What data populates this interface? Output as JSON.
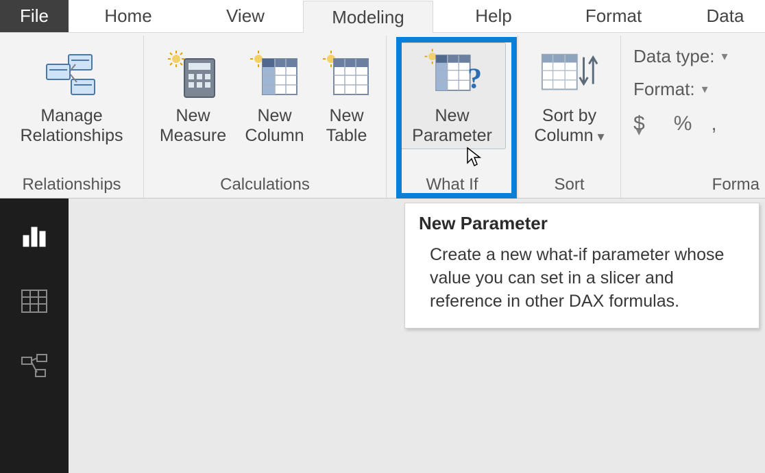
{
  "tabs": {
    "file": "File",
    "home": "Home",
    "view": "View",
    "modeling": "Modeling",
    "help": "Help",
    "format": "Format",
    "data": "Data"
  },
  "ribbon": {
    "relationships": {
      "group_label": "Relationships",
      "manage": "Manage\nRelationships"
    },
    "calculations": {
      "group_label": "Calculations",
      "new_measure": "New\nMeasure",
      "new_column": "New\nColumn",
      "new_table": "New\nTable"
    },
    "whatif": {
      "group_label": "What If",
      "new_parameter": "New\nParameter"
    },
    "sort": {
      "group_label": "Sort",
      "sort_by_column": "Sort by\nColumn"
    },
    "formatting": {
      "group_label": "Forma",
      "data_type": "Data type:",
      "format": "Format:",
      "currency": "$",
      "percent": "%",
      "comma": ","
    }
  },
  "tooltip": {
    "title": "New Parameter",
    "body": "Create a new what-if parameter whose value you can set in a slicer and reference in other DAX formulas."
  }
}
